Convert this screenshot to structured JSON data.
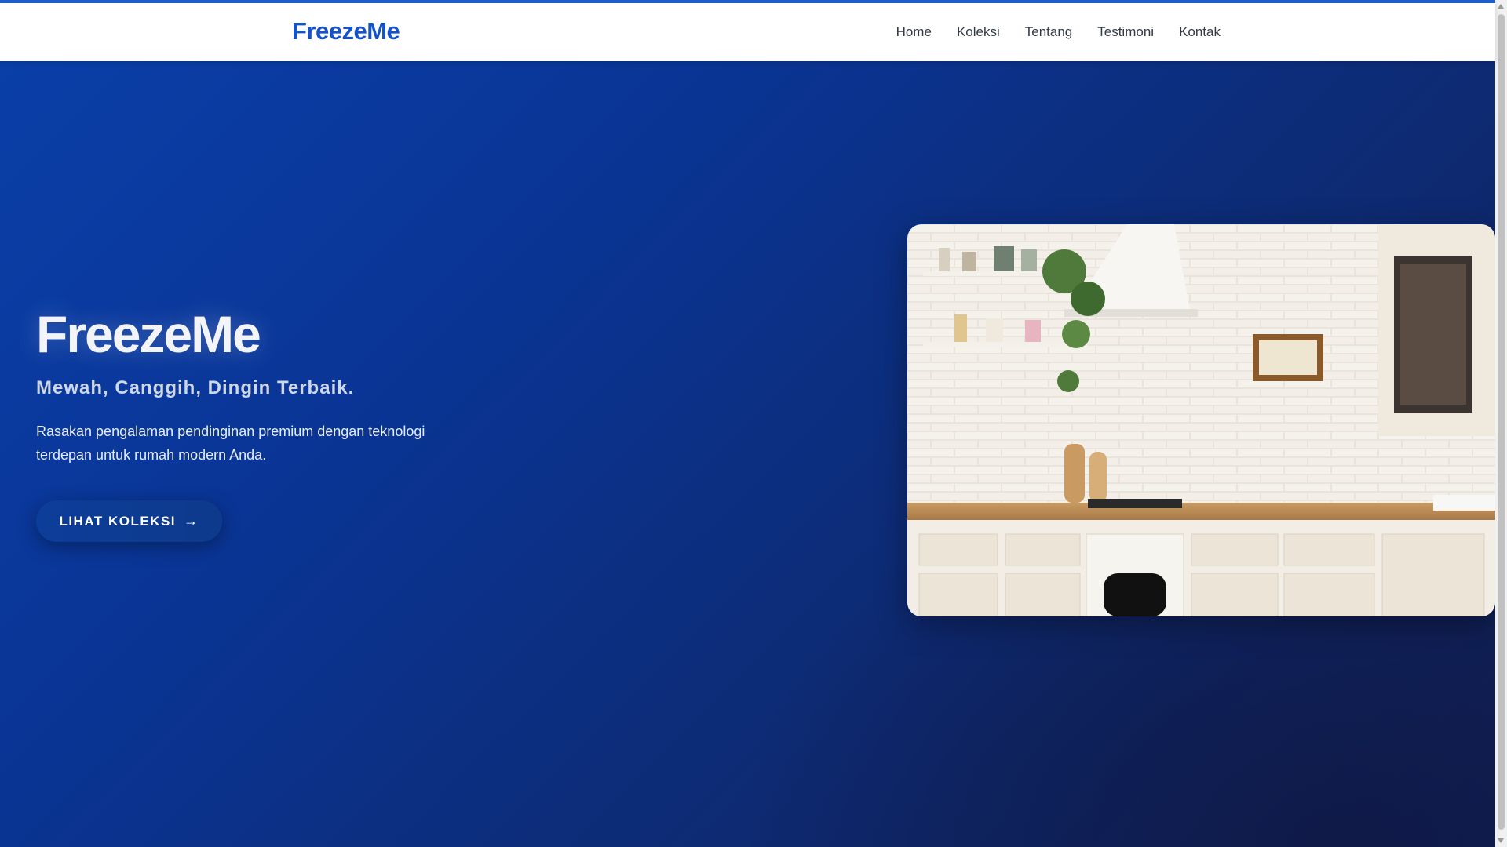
{
  "navbar": {
    "brand": "FreezeMe",
    "links": [
      "Home",
      "Koleksi",
      "Tentang",
      "Testimoni",
      "Kontak"
    ]
  },
  "hero": {
    "title": "FreezeMe",
    "tagline": "Mewah, Canggih, Dingin Terbaik.",
    "description": "Rasakan pengalaman pendinginan premium dengan teknologi terdepan untuk rumah modern Anda.",
    "cta_label": "LIHAT KOLEKSI",
    "cta_icon": "arrow-right-icon"
  },
  "colors": {
    "accent": "#1553c8",
    "hero_start": "#0a3fa8",
    "hero_end": "#101f55"
  }
}
